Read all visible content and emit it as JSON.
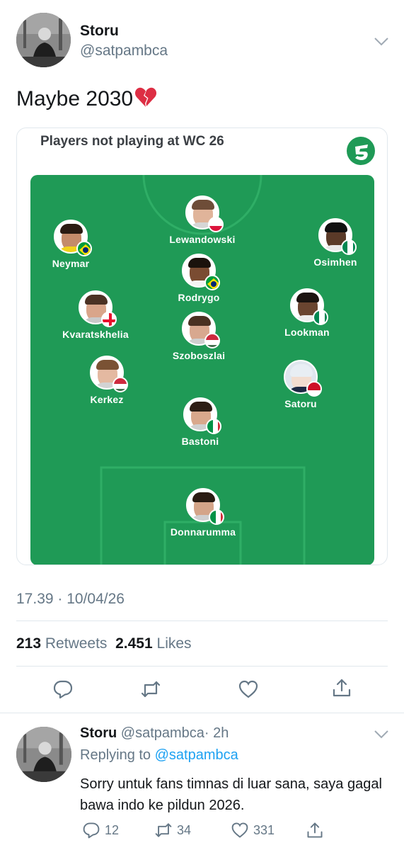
{
  "tweet": {
    "author_name": "Storu",
    "author_handle": "@satpambca",
    "text": "Maybe 2030",
    "emoji": "broken-heart",
    "timestamp": "17.39 · 10/04/26",
    "retweets_count": "213",
    "retweets_label": "Retweets",
    "likes_count": "2.451",
    "likes_label": "Likes"
  },
  "card": {
    "title": "Players not playing at WC 26",
    "players": [
      {
        "name": "Lewandowski",
        "flag": "poland"
      },
      {
        "name": "Neymar",
        "flag": "brazil"
      },
      {
        "name": "Osimhen",
        "flag": "nigeria"
      },
      {
        "name": "Rodrygo",
        "flag": "brazil"
      },
      {
        "name": "Kvaratskhelia",
        "flag": "georgia"
      },
      {
        "name": "Lookman",
        "flag": "nigeria"
      },
      {
        "name": "Szoboszlai",
        "flag": "hungary"
      },
      {
        "name": "Kerkez",
        "flag": "hungary"
      },
      {
        "name": "Satoru",
        "flag": "indonesia"
      },
      {
        "name": "Bastoni",
        "flag": "italy"
      },
      {
        "name": "Donnarumma",
        "flag": "italy"
      }
    ]
  },
  "actions": [
    "reply-icon",
    "retweet-icon",
    "like-icon",
    "share-icon"
  ],
  "reply": {
    "author_name": "Storu",
    "author_handle": "@satpambca",
    "time": "· 2h",
    "replying_prefix": "Replying to",
    "replying_to": "@satpambca",
    "text": "Sorry untuk fans timnas di luar sana, saya gagal bawa indo ke pildun 2026.",
    "reply_count": "12",
    "retweet_count": "34",
    "like_count": "331"
  },
  "colors": {
    "pitch": "#1f9a56",
    "link": "#1da1f2",
    "muted": "#657786",
    "text": "#14171a"
  }
}
